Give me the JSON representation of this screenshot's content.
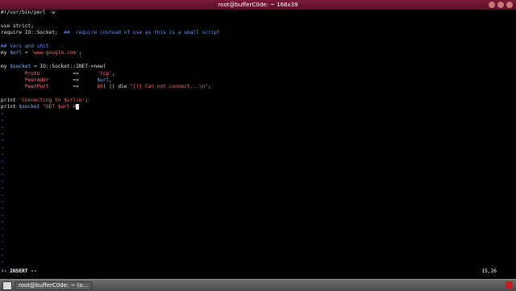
{
  "window": {
    "title": "root@bufferC0de: ~ 168x39"
  },
  "editor": {
    "lines": [
      [
        {
          "t": "#!/usr/bin/perl -w",
          "c": "kw"
        }
      ],
      [],
      [
        {
          "t": "use strict;",
          "c": "kw"
        }
      ],
      [
        {
          "t": "require IO::Socket;  ",
          "c": "kw"
        },
        {
          "t": "##  require instead of use as this is a small script",
          "c": "comment"
        }
      ],
      [],
      [
        {
          "t": "## Vars and shit",
          "c": "comment"
        }
      ],
      [
        {
          "t": "my ",
          "c": "kw"
        },
        {
          "t": "$url",
          "c": "var"
        },
        {
          "t": " = ",
          "c": "kw"
        },
        {
          "t": "'www.google.com'",
          "c": "str"
        },
        {
          "t": ";",
          "c": "kw"
        }
      ],
      [],
      [
        {
          "t": "my ",
          "c": "kw"
        },
        {
          "t": "$socket",
          "c": "var"
        },
        {
          "t": " = IO::Socket::INET->new(",
          "c": "kw"
        }
      ],
      [
        {
          "t": "        ",
          "c": "kw"
        },
        {
          "t": "Proto",
          "c": "purple"
        },
        {
          "t": "           =>      ",
          "c": "kw"
        },
        {
          "t": "'tcp'",
          "c": "str"
        },
        {
          "t": ",",
          "c": "kw"
        }
      ],
      [
        {
          "t": "        ",
          "c": "kw"
        },
        {
          "t": "PeerAddr",
          "c": "purple"
        },
        {
          "t": "        =>      ",
          "c": "kw"
        },
        {
          "t": "$url",
          "c": "var"
        },
        {
          "t": ",",
          "c": "kw"
        }
      ],
      [
        {
          "t": "        ",
          "c": "kw"
        },
        {
          "t": "PeerPort",
          "c": "purple"
        },
        {
          "t": "        =>      ",
          "c": "kw"
        },
        {
          "t": "80",
          "c": "str"
        },
        {
          "t": ") || die ",
          "c": "kw"
        },
        {
          "t": "\"[!] Can not connect...\\n\"",
          "c": "str"
        },
        {
          "t": ";",
          "c": "kw"
        }
      ],
      [],
      [
        {
          "t": "print ",
          "c": "kw"
        },
        {
          "t": "'Connecting to $url\\n'",
          "c": "str"
        },
        {
          "t": ";",
          "c": "kw"
        }
      ],
      [
        {
          "t": "print ",
          "c": "kw"
        },
        {
          "t": "$socket",
          "c": "var"
        },
        {
          "t": " ",
          "c": "kw"
        },
        {
          "t": "\"GET $url H",
          "c": "str"
        },
        {
          "t": " ",
          "c": "cursor"
        }
      ]
    ],
    "tilde_count": 24,
    "tilde_char": "~",
    "mode": "-- INSERT --",
    "cursor_position": "15,26"
  },
  "taskbar": {
    "task_label": "root@bufferC0de: ~ (o..."
  }
}
